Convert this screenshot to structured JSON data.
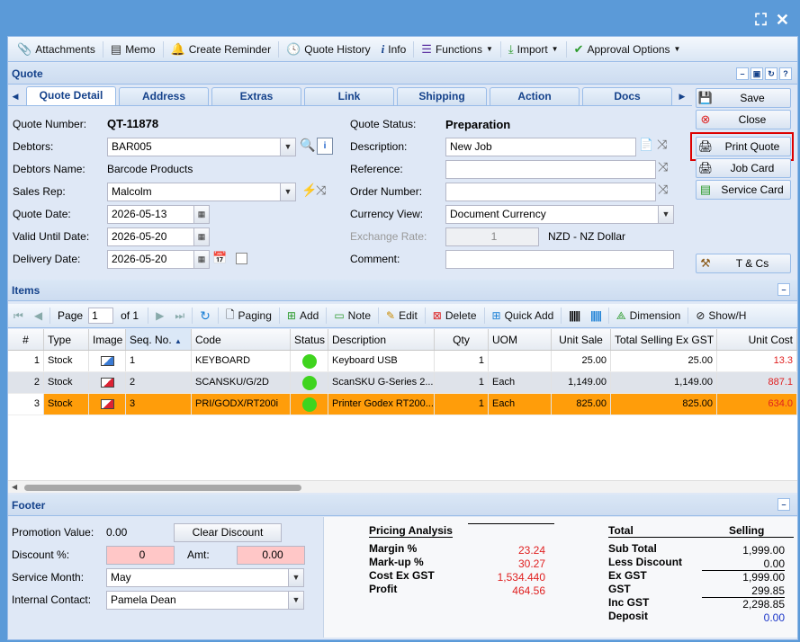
{
  "window": {
    "fullscreen_icon": "fullscreen-icon",
    "close_icon": "close-icon"
  },
  "toolbar": {
    "attachments": "Attachments",
    "memo": "Memo",
    "create_reminder": "Create Reminder",
    "quote_history": "Quote History",
    "info": "Info",
    "functions": "Functions",
    "import": "Import",
    "approval_options": "Approval Options"
  },
  "quote_panel": {
    "title": "Quote"
  },
  "tabs": [
    "Quote Detail",
    "Address",
    "Extras",
    "Link",
    "Shipping",
    "Action",
    "Docs"
  ],
  "form": {
    "quote_number_label": "Quote Number:",
    "quote_number": "QT-11878",
    "debtors_label": "Debtors:",
    "debtors": "BAR005",
    "debtors_name_label": "Debtors Name:",
    "debtors_name": "Barcode Products",
    "sales_rep_label": "Sales Rep:",
    "sales_rep": "Malcolm",
    "quote_date_label": "Quote Date:",
    "quote_date": "2026-05-13",
    "valid_until_label": "Valid Until Date:",
    "valid_until": "2026-05-20",
    "delivery_date_label": "Delivery Date:",
    "delivery_date": "2026-05-20",
    "quote_status_label": "Quote Status:",
    "quote_status": "Preparation",
    "description_label": "Description:",
    "description": "New Job",
    "reference_label": "Reference:",
    "reference": "",
    "order_number_label": "Order Number:",
    "order_number": "",
    "currency_view_label": "Currency View:",
    "currency_view": "Document Currency",
    "exchange_rate_label": "Exchange Rate:",
    "exchange_rate": "1",
    "currency_name": "NZD - NZ Dollar",
    "comment_label": "Comment:",
    "comment": ""
  },
  "side_buttons": {
    "save": "Save",
    "close": "Close",
    "print_quote": "Print Quote",
    "job_card": "Job Card",
    "service_card": "Service Card",
    "tcs": "T & Cs"
  },
  "items_panel": {
    "title": "Items"
  },
  "items_toolbar": {
    "page_label": "Page",
    "page_value": "1",
    "of_label": "of 1",
    "paging": "Paging",
    "add": "Add",
    "note": "Note",
    "edit": "Edit",
    "delete": "Delete",
    "quick_add": "Quick Add",
    "dimension": "Dimension",
    "show_hide": "Show/H"
  },
  "grid": {
    "columns": [
      "#",
      "Type",
      "Image",
      "Seq. No.",
      "Code",
      "Status",
      "Description",
      "Qty",
      "UOM",
      "Unit Sale",
      "Total Selling Ex GST",
      "Unit Cost"
    ],
    "rows": [
      {
        "num": "1",
        "type": "Stock",
        "seq": "1",
        "code": "KEYBOARD",
        "desc": "Keyboard USB",
        "qty": "1",
        "uom": "",
        "unit_sale": "25.00",
        "total": "25.00",
        "unit_cost": "13.3"
      },
      {
        "num": "2",
        "type": "Stock",
        "seq": "2",
        "code": "SCANSKU/G/2D",
        "desc": "ScanSKU G-Series 2...",
        "qty": "1",
        "uom": "Each",
        "unit_sale": "1,149.00",
        "total": "1,149.00",
        "unit_cost": "887.1"
      },
      {
        "num": "3",
        "type": "Stock",
        "seq": "3",
        "code": "PRI/GODX/RT200i",
        "desc": "Printer Godex RT200...",
        "qty": "1",
        "uom": "Each",
        "unit_sale": "825.00",
        "total": "825.00",
        "unit_cost": "634.0"
      }
    ]
  },
  "footer": {
    "title": "Footer",
    "promotion_label": "Promotion Value:",
    "promotion_value": "0.00",
    "clear_discount": "Clear Discount",
    "discount_label": "Discount %:",
    "discount_value": "0",
    "amt_label": "Amt:",
    "amt_value": "0.00",
    "service_month_label": "Service Month:",
    "service_month": "May",
    "internal_contact_label": "Internal Contact:",
    "internal_contact": "Pamela Dean"
  },
  "pricing": {
    "title": "Pricing Analysis",
    "margin_label": "Margin %",
    "margin": "23.24",
    "markup_label": "Mark-up %",
    "markup": "30.27",
    "cost_label": "Cost Ex GST",
    "cost": "1,534.440",
    "profit_label": "Profit",
    "profit": "464.56"
  },
  "totals": {
    "total_label": "Total",
    "selling_label": "Selling",
    "subtotal_label": "Sub Total",
    "subtotal": "1,999.00",
    "less_discount_label": "Less Discount",
    "less_discount": "0.00",
    "ex_gst_label": "Ex GST",
    "ex_gst": "1,999.00",
    "gst_label": "GST",
    "gst": "299.85",
    "inc_gst_label": "Inc GST",
    "inc_gst": "2,298.85",
    "deposit_label": "Deposit",
    "deposit": "0.00"
  }
}
